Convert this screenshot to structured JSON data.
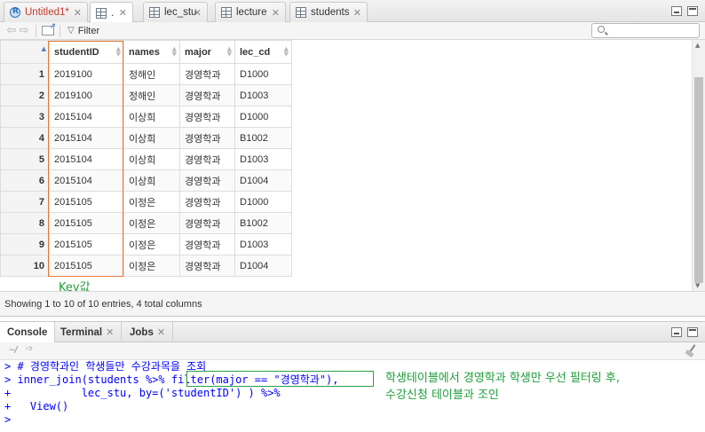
{
  "editor_tabs": [
    {
      "label": "Untitled1*",
      "icon": "r-script-icon",
      "unsaved": true
    },
    {
      "label": ".",
      "icon": "table-icon",
      "active": true
    },
    {
      "label": "lec_stu",
      "icon": "table-icon"
    },
    {
      "label": "lecture",
      "icon": "table-icon"
    },
    {
      "label": "students",
      "icon": "table-icon"
    }
  ],
  "toolbar": {
    "filter_label": "Filter",
    "search_placeholder": ""
  },
  "grid": {
    "columns": [
      "studentID",
      "names",
      "major",
      "lec_cd"
    ],
    "rows": [
      {
        "n": "1",
        "studentID": "2019100",
        "names": "정해인",
        "major": "경영학과",
        "lec_cd": "D1000"
      },
      {
        "n": "2",
        "studentID": "2019100",
        "names": "정해인",
        "major": "경영학과",
        "lec_cd": "D1003"
      },
      {
        "n": "3",
        "studentID": "2015104",
        "names": "이상희",
        "major": "경영학과",
        "lec_cd": "D1000"
      },
      {
        "n": "4",
        "studentID": "2015104",
        "names": "이상희",
        "major": "경영학과",
        "lec_cd": "B1002"
      },
      {
        "n": "5",
        "studentID": "2015104",
        "names": "이상희",
        "major": "경영학과",
        "lec_cd": "D1003"
      },
      {
        "n": "6",
        "studentID": "2015104",
        "names": "이상희",
        "major": "경영학과",
        "lec_cd": "D1004"
      },
      {
        "n": "7",
        "studentID": "2015105",
        "names": "이정은",
        "major": "경영학과",
        "lec_cd": "D1000"
      },
      {
        "n": "8",
        "studentID": "2015105",
        "names": "이정은",
        "major": "경영학과",
        "lec_cd": "B1002"
      },
      {
        "n": "9",
        "studentID": "2015105",
        "names": "이정은",
        "major": "경영학과",
        "lec_cd": "D1003"
      },
      {
        "n": "10",
        "studentID": "2015105",
        "names": "이정은",
        "major": "경영학과",
        "lec_cd": "D1004"
      }
    ],
    "key_annotation": "Key값",
    "highlight_color": "#e07b3a"
  },
  "status": {
    "text": "Showing 1 to 10 of 10 entries, 4 total columns"
  },
  "console_tabs": [
    {
      "label": "Console",
      "active": true
    },
    {
      "label": "Terminal"
    },
    {
      "label": "Jobs"
    }
  ],
  "console": {
    "path": "~/",
    "lines": [
      "> # 경영학과인 학생들만 수강과목을 조회",
      "> inner_join(students %>% filter(major == \"경영학과\"),",
      "+           lec_stu, by=('studentID') ) %>%",
      "+   View()",
      ">"
    ],
    "annotation_line1": "학생테이블에서 경영학과 학생만 우선 필터링 후,",
    "annotation_line2": "수강신청 테이블과 조인",
    "annotation_color": "#1f9e3a"
  }
}
